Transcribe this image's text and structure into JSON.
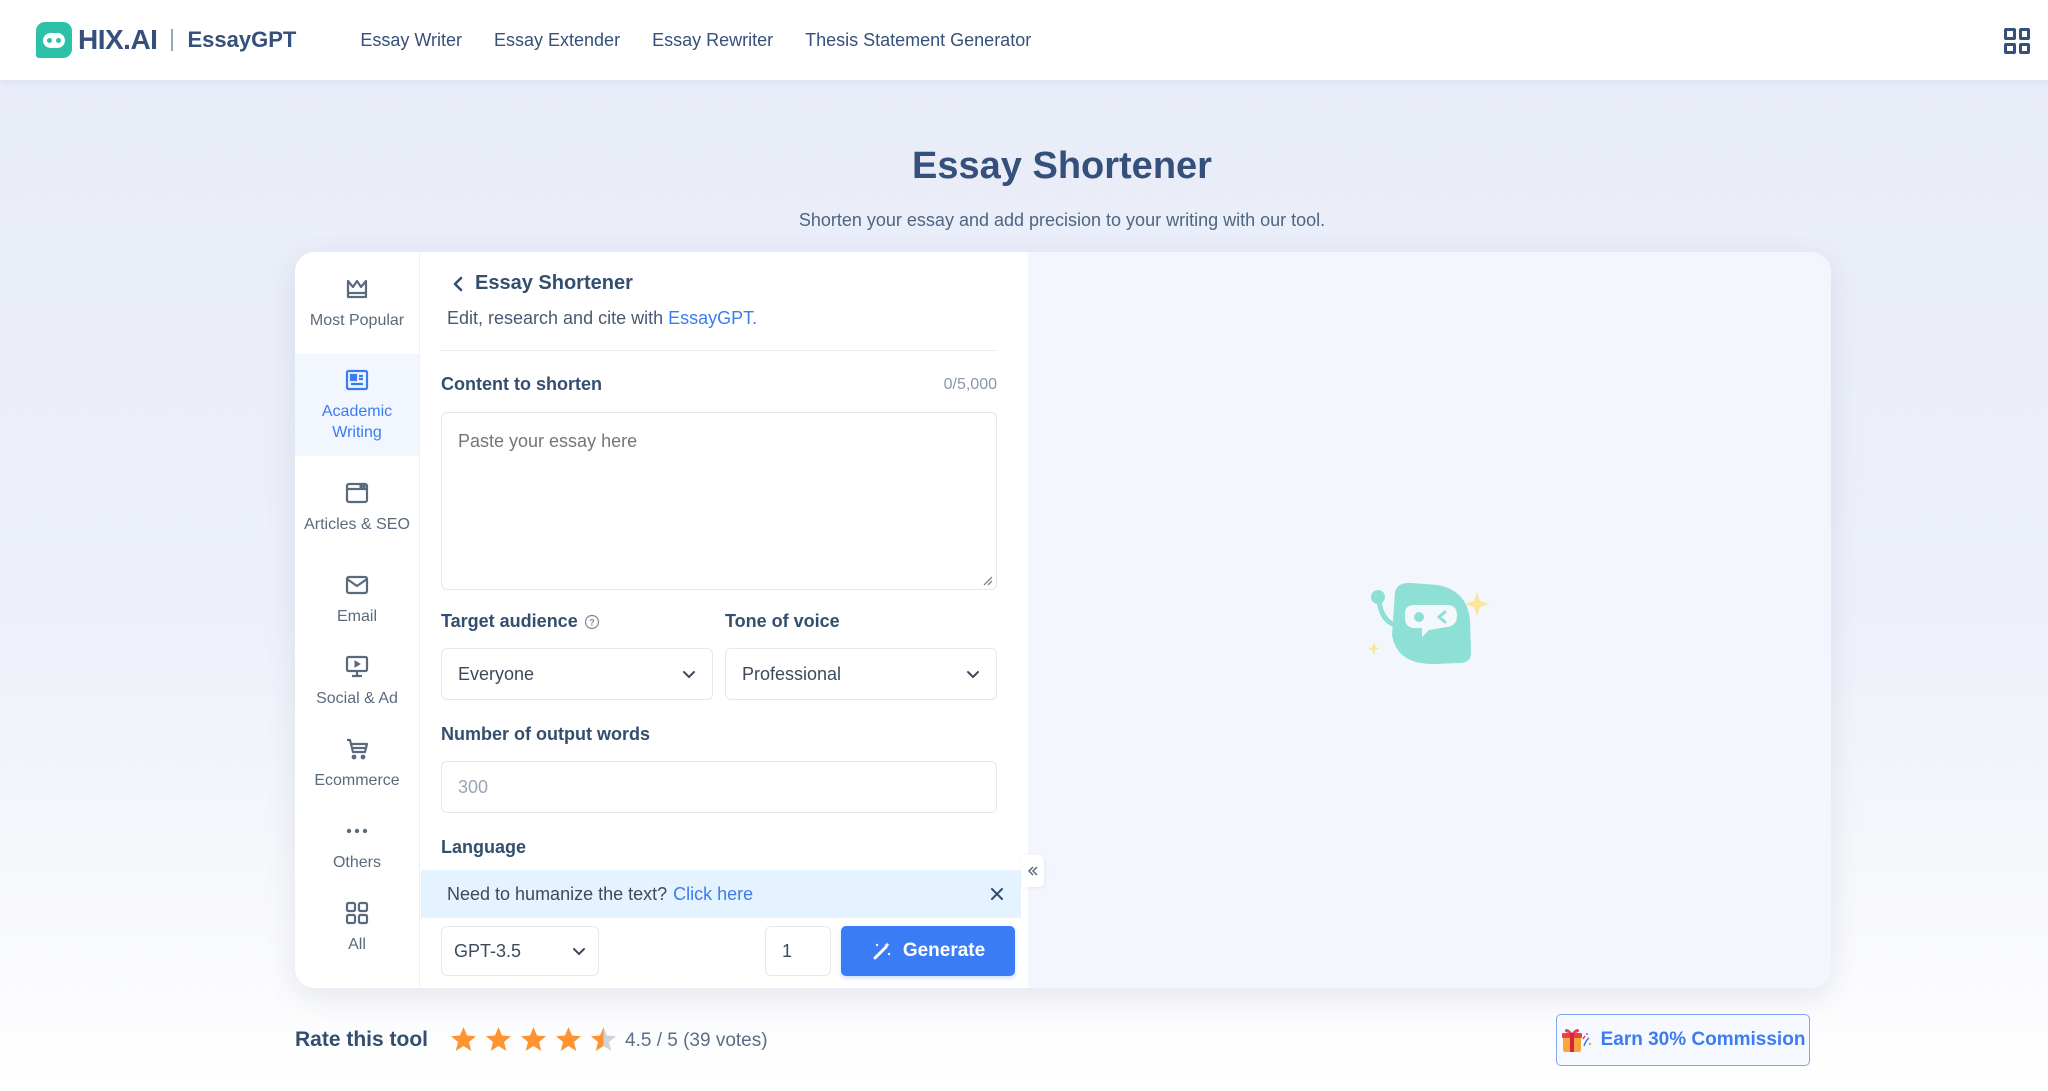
{
  "header": {
    "brand_name": "HIX.AI",
    "product_name": "EssayGPT",
    "nav": [
      {
        "label": "Essay Writer"
      },
      {
        "label": "Essay Extender"
      },
      {
        "label": "Essay Rewriter"
      },
      {
        "label": "Thesis Statement Generator"
      }
    ],
    "apps_icon": "grid-icon"
  },
  "hero": {
    "title": "Essay Shortener",
    "subtitle": "Shorten your essay and add precision to your writing with our tool."
  },
  "sidebar": {
    "active_index": 1,
    "items": [
      {
        "label": "Most Popular",
        "icon": "crown-icon"
      },
      {
        "label": "Academic Writing",
        "icon": "newspaper-icon"
      },
      {
        "label": "Articles & SEO",
        "icon": "browser-window-icon"
      },
      {
        "label": "Email",
        "icon": "envelope-icon"
      },
      {
        "label": "Social & Ad",
        "icon": "monitor-play-icon"
      },
      {
        "label": "Ecommerce",
        "icon": "cart-icon"
      },
      {
        "label": "Others",
        "icon": "more-dots-icon"
      },
      {
        "label": "All",
        "icon": "grid-icon"
      }
    ]
  },
  "form": {
    "title": "Essay Shortener",
    "subtitle_prefix": "Edit, research and cite with ",
    "subtitle_link": "EssayGPT.",
    "content": {
      "label": "Content to shorten",
      "counter": "0/5,000",
      "placeholder": "Paste your essay here",
      "value": ""
    },
    "audience": {
      "label": "Target audience",
      "value": "Everyone"
    },
    "tone": {
      "label": "Tone of voice",
      "value": "Professional"
    },
    "words": {
      "label": "Number of output words",
      "placeholder": "300"
    },
    "language": {
      "label": "Language"
    },
    "banner": {
      "text": "Need to humanize the text?",
      "link": "Click here"
    },
    "model": {
      "value": "GPT-3.5"
    },
    "count": {
      "value": "1"
    },
    "generate_label": "Generate"
  },
  "rating": {
    "label": "Rate this tool",
    "score": 4.5,
    "max": 5,
    "text": "4.5 / 5 (39 votes)"
  },
  "earn": {
    "label": "Earn 30% Commission"
  },
  "colors": {
    "primary": "#3a7cf6",
    "brand_teal": "#2bc2a8",
    "text_dark": "#334e6f",
    "star": "#fd9431",
    "star_empty": "#d0d4da"
  }
}
